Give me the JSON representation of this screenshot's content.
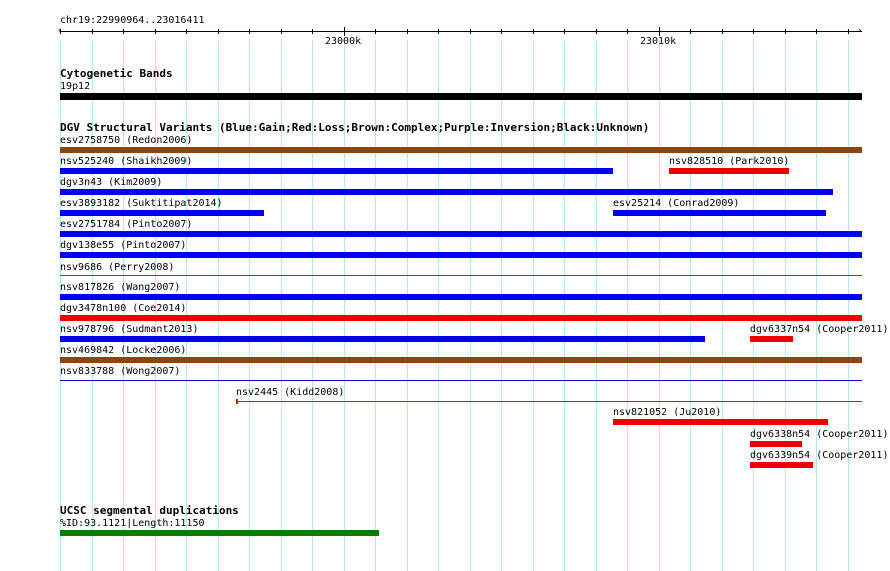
{
  "header": {
    "position": "chr19:22990964..23016411"
  },
  "ruler": {
    "major_labels": [
      "23000k",
      "23010k"
    ],
    "colors": {
      "axis": "#000000"
    }
  },
  "colors": {
    "grid": "#b9e3f0",
    "blue": "#0000ee",
    "red": "#ee0000",
    "brown": "#8b4513",
    "green": "#008000",
    "black": "#000000"
  },
  "tracks": {
    "cytoband": {
      "title": "Cytogenetic Bands",
      "band_label": "19p12"
    },
    "dgv": {
      "title": "DGV Structural Variants (Blue:Gain;Red:Loss;Brown:Complex;Purple:Inversion;Black:Unknown)",
      "features": [
        {
          "label": "esv2758750 (Redon2006)",
          "type": "brown"
        },
        {
          "label": "nsv525240 (Shaikh2009)",
          "type": "blue"
        },
        {
          "label": "nsv828510 (Park2010)",
          "type": "red"
        },
        {
          "label": "dgv3n43 (Kim2009)",
          "type": "blue"
        },
        {
          "label": "esv3893182 (Suktitipat2014)",
          "type": "blue"
        },
        {
          "label": "esv25214 (Conrad2009)",
          "type": "blue"
        },
        {
          "label": "esv2751784 (Pinto2007)",
          "type": "blue"
        },
        {
          "label": "dgv138e55 (Pinto2007)",
          "type": "blue"
        },
        {
          "label": "nsv9686 (Perry2008)",
          "type": "brown"
        },
        {
          "label": "nsv817826 (Wang2007)",
          "type": "blue"
        },
        {
          "label": "dgv3478n100 (Coe2014)",
          "type": "red"
        },
        {
          "label": "nsv978796 (Sudmant2013)",
          "type": "blue"
        },
        {
          "label": "dgv6337n54 (Cooper2011)",
          "type": "red"
        },
        {
          "label": "nsv469842 (Locke2006)",
          "type": "brown"
        },
        {
          "label": "nsv833788 (Wong2007)",
          "type": "blue"
        },
        {
          "label": "nsv2445 (Kidd2008)",
          "type": "red"
        },
        {
          "label": "nsv821052 (Ju2010)",
          "type": "red"
        },
        {
          "label": "dgv6338n54 (Cooper2011)",
          "type": "red"
        },
        {
          "label": "dgv6339n54 (Cooper2011)",
          "type": "red"
        }
      ]
    },
    "segdup": {
      "title": "UCSC segmental duplications",
      "feature_label": "%ID:93.1121|Length:11150"
    }
  }
}
